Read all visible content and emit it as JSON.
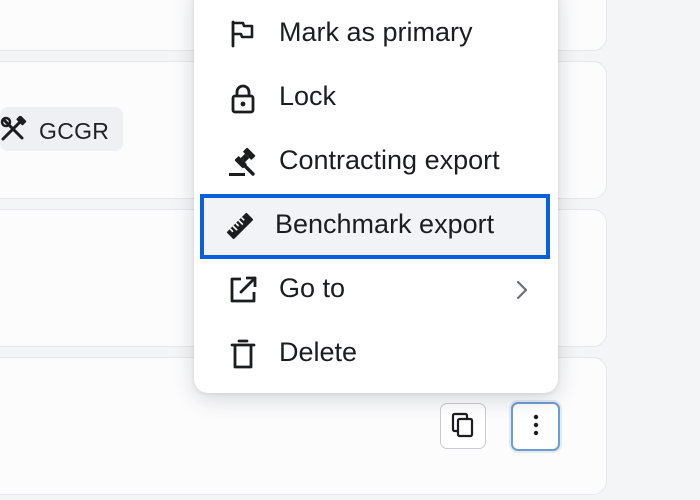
{
  "tag": {
    "label": "GCGR",
    "icon": "hammer-wrench-icon"
  },
  "menu": {
    "items": [
      {
        "label": "Mark as primary",
        "icon": "flag-icon"
      },
      {
        "label": "Lock",
        "icon": "lock-icon"
      },
      {
        "label": "Contracting export",
        "icon": "gavel-icon"
      },
      {
        "label": "Benchmark export",
        "icon": "ruler-icon",
        "focused": true
      },
      {
        "label": "Go to",
        "icon": "external-link-icon",
        "submenu": true
      },
      {
        "label": "Delete",
        "icon": "trash-icon"
      }
    ]
  },
  "actions": {
    "copy": {
      "icon": "copy-icon"
    },
    "more": {
      "icon": "more-vertical-icon"
    }
  },
  "colors": {
    "focus": "#0a5fdc",
    "card_bg": "#fcfcfd",
    "page_bg": "#f4f5f7",
    "tag_bg": "#eef0f3"
  }
}
